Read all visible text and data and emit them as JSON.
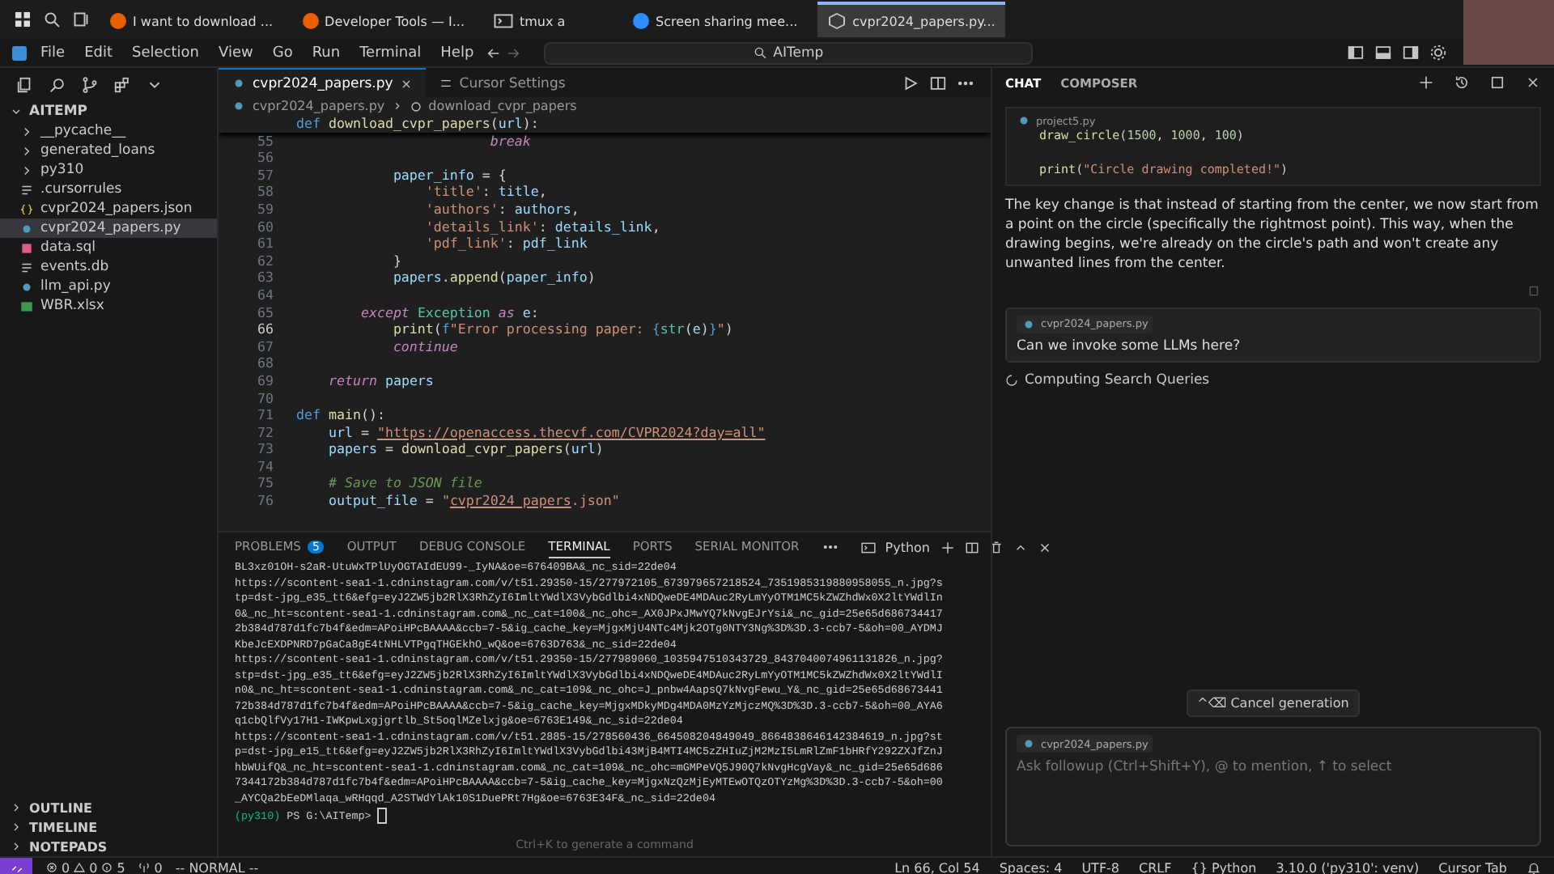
{
  "taskbar": {
    "tasks": [
      {
        "label": "I want to download ...",
        "kind": "browser",
        "selected": false
      },
      {
        "label": "Developer Tools — I...",
        "kind": "browser",
        "selected": false
      },
      {
        "label": "tmux a",
        "kind": "terminal",
        "selected": false
      },
      {
        "label": "Screen sharing mee...",
        "kind": "meeting",
        "selected": false
      },
      {
        "label": "cvpr2024_papers.py...",
        "kind": "editor",
        "selected": true
      }
    ]
  },
  "menubar": {
    "items": [
      "File",
      "Edit",
      "Selection",
      "View",
      "Go",
      "Run",
      "Terminal",
      "Help"
    ],
    "search": {
      "value": "AITemp"
    }
  },
  "explorer": {
    "root": {
      "label": "AITEMP",
      "expanded": true,
      "children": [
        {
          "label": "__pycache__",
          "kind": "folder",
          "expanded": false,
          "selected": false
        },
        {
          "label": "generated_loans",
          "kind": "folder",
          "expanded": false,
          "selected": false
        },
        {
          "label": "py310",
          "kind": "folder",
          "expanded": false,
          "selected": false
        },
        {
          "label": ".cursorrules",
          "kind": "text",
          "selected": false
        },
        {
          "label": "cvpr2024_papers.json",
          "kind": "json",
          "selected": false
        },
        {
          "label": "cvpr2024_papers.py",
          "kind": "python",
          "selected": true
        },
        {
          "label": "data.sql",
          "kind": "sql",
          "selected": false
        },
        {
          "label": "events.db",
          "kind": "text",
          "selected": false
        },
        {
          "label": "llm_api.py",
          "kind": "python",
          "selected": false
        },
        {
          "label": "WBR.xlsx",
          "kind": "excel",
          "selected": false
        }
      ]
    },
    "sections": [
      {
        "label": "OUTLINE",
        "expanded": false
      },
      {
        "label": "TIMELINE",
        "expanded": false
      },
      {
        "label": "NOTEPADS",
        "expanded": false
      }
    ]
  },
  "editor": {
    "tabs": [
      {
        "label": "cvpr2024_papers.py",
        "kind": "python",
        "selected": true
      },
      {
        "label": "Cursor Settings",
        "kind": "settings",
        "selected": false
      }
    ],
    "breadcrumb": [
      "cvpr2024_papers.py",
      "download_cvpr_papers"
    ],
    "sticky": [
      {
        "kind": "kw",
        "text": "def "
      },
      {
        "kind": "fn",
        "text": "download_cvpr_papers"
      },
      {
        "kind": "plain",
        "text": "("
      },
      {
        "kind": "var",
        "text": "url"
      },
      {
        "kind": "plain",
        "text": "):"
      }
    ],
    "lines": [
      {
        "num": "55",
        "current": false,
        "tokens": [
          {
            "kind": "ctrl",
            "text": "                        break"
          }
        ]
      },
      {
        "num": "56",
        "current": false
      },
      {
        "num": "57",
        "current": false,
        "tokens": [
          {
            "kind": "var",
            "text": "            paper_info"
          },
          {
            "kind": "plain",
            "text": " = {"
          }
        ]
      },
      {
        "num": "58",
        "current": false,
        "tokens": [
          {
            "kind": "str",
            "text": "                'title'"
          },
          {
            "kind": "plain",
            "text": ": "
          },
          {
            "kind": "var",
            "text": "title"
          },
          {
            "kind": "plain",
            "text": ","
          }
        ]
      },
      {
        "num": "59",
        "current": false,
        "tokens": [
          {
            "kind": "str",
            "text": "                'authors'"
          },
          {
            "kind": "plain",
            "text": ": "
          },
          {
            "kind": "var",
            "text": "authors"
          },
          {
            "kind": "plain",
            "text": ","
          }
        ]
      },
      {
        "num": "60",
        "current": false,
        "tokens": [
          {
            "kind": "str",
            "text": "                'details_link'"
          },
          {
            "kind": "plain",
            "text": ": "
          },
          {
            "kind": "var",
            "text": "details_link"
          },
          {
            "kind": "plain",
            "text": ","
          }
        ]
      },
      {
        "num": "61",
        "current": false,
        "tokens": [
          {
            "kind": "str",
            "text": "                'pdf_link'"
          },
          {
            "kind": "plain",
            "text": ": "
          },
          {
            "kind": "var",
            "text": "pdf_link"
          }
        ]
      },
      {
        "num": "62",
        "current": false,
        "tokens": [
          {
            "kind": "plain",
            "text": "            }"
          }
        ]
      },
      {
        "num": "63",
        "current": false,
        "tokens": [
          {
            "kind": "var",
            "text": "            papers"
          },
          {
            "kind": "plain",
            "text": "."
          },
          {
            "kind": "fn",
            "text": "append"
          },
          {
            "kind": "plain",
            "text": "("
          },
          {
            "kind": "var",
            "text": "paper_info"
          },
          {
            "kind": "plain",
            "text": ")"
          }
        ]
      },
      {
        "num": "64",
        "current": false
      },
      {
        "num": "65",
        "current": false,
        "tokens": [
          {
            "kind": "ctrl",
            "text": "        except "
          },
          {
            "kind": "type",
            "text": "Exception"
          },
          {
            "kind": "ctrl",
            "text": " as "
          },
          {
            "kind": "var",
            "text": "e"
          },
          {
            "kind": "plain",
            "text": ":"
          }
        ]
      },
      {
        "num": "66",
        "current": true,
        "tokens": [
          {
            "kind": "fn",
            "text": "            print"
          },
          {
            "kind": "plain",
            "text": "("
          },
          {
            "kind": "kw",
            "text": "f"
          },
          {
            "kind": "str",
            "text": "\"Error processing paper: "
          },
          {
            "kind": "kw",
            "text": "{"
          },
          {
            "kind": "type",
            "text": "str"
          },
          {
            "kind": "plain",
            "text": "("
          },
          {
            "kind": "var",
            "text": "e"
          },
          {
            "kind": "plain",
            "text": ")"
          },
          {
            "kind": "kw",
            "text": "}"
          },
          {
            "kind": "str",
            "text": "\""
          },
          {
            "kind": "plain",
            "text": ")"
          }
        ]
      },
      {
        "num": "67",
        "current": false,
        "tokens": [
          {
            "kind": "ctrl",
            "text": "            continue"
          }
        ]
      },
      {
        "num": "68",
        "current": false
      },
      {
        "num": "69",
        "current": false,
        "tokens": [
          {
            "kind": "ctrl",
            "text": "    return "
          },
          {
            "kind": "var",
            "text": "papers"
          }
        ]
      },
      {
        "num": "70",
        "current": false
      },
      {
        "num": "71",
        "current": false,
        "tokens": [
          {
            "kind": "kw",
            "text": "def "
          },
          {
            "kind": "fn",
            "text": "main"
          },
          {
            "kind": "plain",
            "text": "():"
          }
        ]
      },
      {
        "num": "72",
        "current": false,
        "tokens": [
          {
            "kind": "var",
            "text": "    url"
          },
          {
            "kind": "plain",
            "text": " = "
          },
          {
            "kind": "url",
            "text": "\"https://openaccess.thecvf.com/CVPR2024?day=all\""
          }
        ]
      },
      {
        "num": "73",
        "current": false,
        "tokens": [
          {
            "kind": "var",
            "text": "    papers"
          },
          {
            "kind": "plain",
            "text": " = "
          },
          {
            "kind": "fn",
            "text": "download_cvpr_papers"
          },
          {
            "kind": "plain",
            "text": "("
          },
          {
            "kind": "var",
            "text": "url"
          },
          {
            "kind": "plain",
            "text": ")"
          }
        ]
      },
      {
        "num": "74",
        "current": false
      },
      {
        "num": "75",
        "current": false,
        "tokens": [
          {
            "kind": "comment",
            "text": "    # Save to JSON file"
          }
        ]
      },
      {
        "num": "76",
        "current": false,
        "tokens": [
          {
            "kind": "var",
            "text": "    output_file"
          },
          {
            "kind": "plain",
            "text": " = "
          },
          {
            "kind": "str",
            "text": "\""
          },
          {
            "kind": "url",
            "text": "cvpr2024_papers"
          },
          {
            "kind": "str",
            "text": ".json\""
          }
        ]
      }
    ]
  },
  "panel": {
    "tabs": [
      {
        "label": "PROBLEMS",
        "badge": "5",
        "selected": false
      },
      {
        "label": "OUTPUT",
        "selected": false
      },
      {
        "label": "DEBUG CONSOLE",
        "selected": false
      },
      {
        "label": "TERMINAL",
        "selected": true
      },
      {
        "label": "PORTS",
        "selected": false
      },
      {
        "label": "SERIAL MONITOR",
        "selected": false
      }
    ],
    "shell": "Python",
    "terminal_lines": [
      "BL3xz01OH-s2aR-UtuWxTPlUyOGTAIdEU99-_IyNA&oe=676409BA&_nc_sid=22de04",
      "https://scontent-sea1-1.cdninstagram.com/v/t51.29350-15/277972105_673979657218524_7351985319880958055_n.jpg?s",
      "tp=dst-jpg_e35_tt6&efg=eyJ2ZW5jb2RlX3RhZyI6ImltYWdlX3VybGdlbi4xNDQweDE4MDAuc2RyLmYyOTM1MC5kZWZhdWx0X2ltYWdlIn",
      "0&_nc_ht=scontent-sea1-1.cdninstagram.com&_nc_cat=100&_nc_ohc=_AX0JPxJMwYQ7kNvgEJrYsi&_nc_gid=25e65d686734417",
      "2b384d787d1fc7b4f&edm=APoiHPcBAAAA&ccb=7-5&ig_cache_key=MjgxMjU4NTc4Mjk2OTg0NTY3Ng%3D%3D.3-ccb7-5&oh=00_AYDMJ",
      "KbeJcEXDPNRD7pGaCa8gE4tNHLVTPgqTHGEkhO_wQ&oe=6763D763&_nc_sid=22de04",
      "https://scontent-sea1-1.cdninstagram.com/v/t51.29350-15/277989060_1035947510343729_8437040074961131826_n.jpg?",
      "stp=dst-jpg_e35_tt6&efg=eyJ2ZW5jb2RlX3RhZyI6ImltYWdlX3VybGdlbi4xNDQweDE4MDAuc2RyLmYyOTM1MC5kZWZhdWx0X2ltYWdlI",
      "n0&_nc_ht=scontent-sea1-1.cdninstagram.com&_nc_cat=109&_nc_ohc=J_pnbw4AapsQ7kNvgFewu_Y&_nc_gid=25e65d68673441",
      "72b384d787d1fc7b4f&edm=APoiHPcBAAAA&ccb=7-5&ig_cache_key=MjgxMDkyMDg4MDA0MzYzMjczMQ%3D%3D.3-ccb7-5&oh=00_AYA6",
      "q1cbQlfVy17H1-IWKpwLxgjgrtlb_St5oqlMZelxjg&oe=6763E149&_nc_sid=22de04",
      "https://scontent-sea1-1.cdninstagram.com/v/t51.2885-15/278560436_664508204849049_8664838646142384619_n.jpg?st",
      "p=dst-jpg_e15_tt6&efg=eyJ2ZW5jb2RlX3RhZyI6ImltYWdlX3VybGdlbi43MjB4MTI4MC5zZHIuZjM2MzI5LmRlZmF1bHRfY292ZXJfZnJ",
      "hbWUifQ&_nc_ht=scontent-sea1-1.cdninstagram.com&_nc_cat=109&_nc_ohc=mGMPeVQ5J90Q7kNvgHcgVay&_nc_gid=25e65d686",
      "7344172b384d787d1fc7b4f&edm=APoiHPcBAAAA&ccb=7-5&ig_cache_key=MjgxNzQzMjEyMTEwOTQzOTYzMg%3D%3D.3-ccb7-5&oh=00",
      "_AYCQa2bEeDMlaqa_wRHqqd_A2STWdYlAk10S1DuePRt7Hg&oe=6763E34F&_nc_sid=22de04"
    ],
    "prompt_env": "(py310)",
    "prompt": "PS G:\\AITemp>",
    "hint": "Ctrl+K to generate a command"
  },
  "chat": {
    "tabs": [
      {
        "label": "CHAT",
        "selected": true
      },
      {
        "label": "COMPOSER",
        "selected": false
      }
    ],
    "code_file": "project5.py",
    "code": [
      {
        "kind": "code",
        "tokens": [
          {
            "kind": "fn",
            "text": "draw_circle"
          },
          {
            "kind": "plain",
            "text": "("
          },
          {
            "kind": "num",
            "text": "1500"
          },
          {
            "kind": "plain",
            "text": ", "
          },
          {
            "kind": "num",
            "text": "1000"
          },
          {
            "kind": "plain",
            "text": ", "
          },
          {
            "kind": "num",
            "text": "100"
          },
          {
            "kind": "plain",
            "text": ")"
          }
        ]
      },
      {
        "kind": "blank"
      },
      {
        "kind": "code",
        "tokens": [
          {
            "kind": "fn",
            "text": "print"
          },
          {
            "kind": "plain",
            "text": "("
          },
          {
            "kind": "str",
            "text": "\"Circle drawing completed!\""
          },
          {
            "kind": "plain",
            "text": ")"
          }
        ]
      }
    ],
    "answer": "The key change is that instead of starting from the center, we now start from a point on the circle (specifically the rightmost point). This way, when the drawing begins, we're already on the circle's path and won't create any unwanted lines from the center.",
    "message_file": "cvpr2024_papers.py",
    "message": "Can we invoke some LLMs here?",
    "status": "Computing Search Queries",
    "cancel": "^⌫ Cancel generation",
    "input_file": "cvpr2024_papers.py",
    "input_placeholder": "Ask followup (Ctrl+Shift+Y), @ to mention, ↑ to select"
  },
  "status_bar": {
    "errors": "0",
    "warnings": "0",
    "info": "5",
    "ports": "0",
    "mode": "-- NORMAL --",
    "right": [
      "Ln 66, Col 54",
      "Spaces: 4",
      "UTF-8",
      "CRLF",
      "{} Python",
      "3.10.0 ('py310': venv)",
      "Cursor Tab"
    ]
  }
}
